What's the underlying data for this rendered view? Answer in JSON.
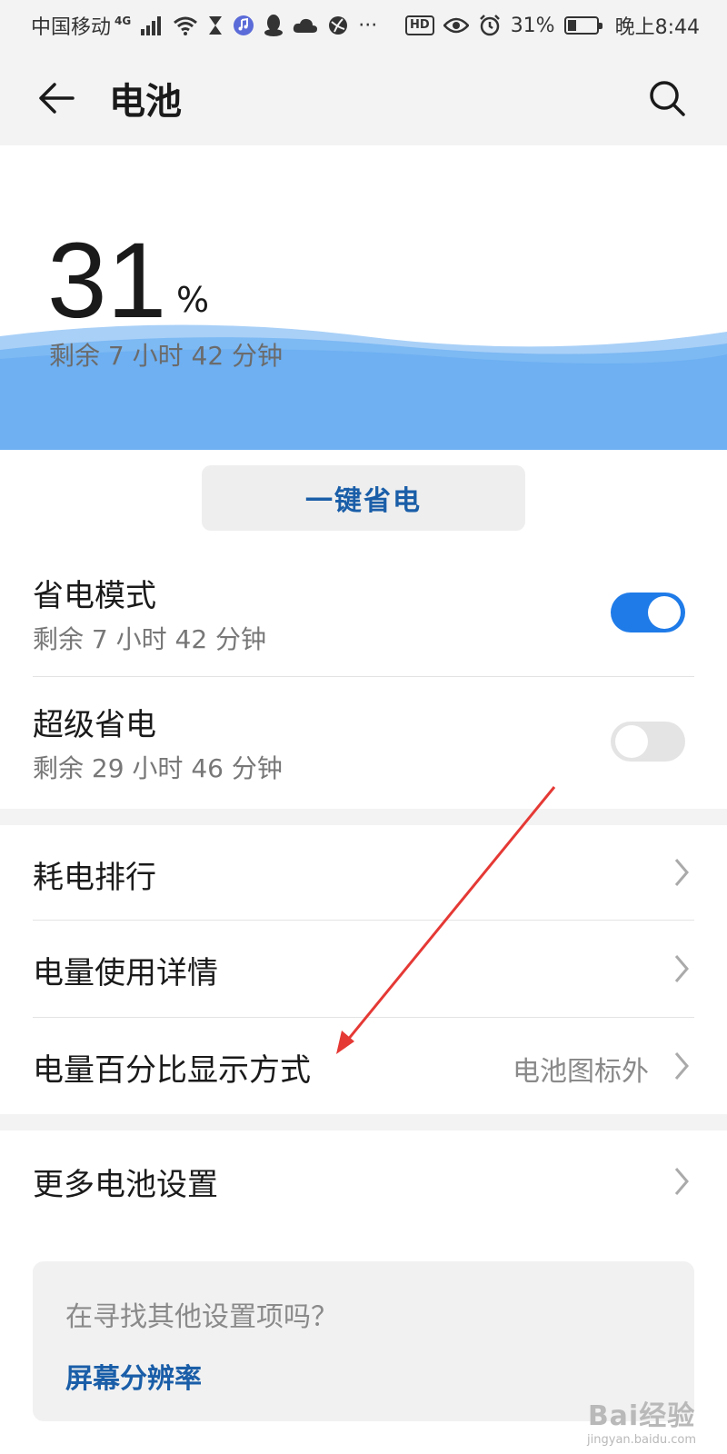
{
  "statusbar": {
    "carrier": "中国移动",
    "network": "4G",
    "hd_label": "HD",
    "battery_percent": "31%",
    "time": "晚上8:44",
    "battery_level": 0.31
  },
  "header": {
    "title": "电池"
  },
  "hero": {
    "percent_value": "31",
    "percent_sign": "%",
    "remaining": "剩余 7 小时 42 分钟",
    "wave_color": "#6eb0f2"
  },
  "one_key_button": {
    "label": "一键省电"
  },
  "power_saving": {
    "title": "省电模式",
    "subtitle": "剩余 7 小时 42 分钟",
    "enabled": true
  },
  "ultra_saving": {
    "title": "超级省电",
    "subtitle": "剩余 29 小时 46 分钟",
    "enabled": false
  },
  "menu": {
    "ranking": {
      "label": "耗电排行"
    },
    "usage_details": {
      "label": "电量使用详情"
    },
    "percent_display": {
      "label": "电量百分比显示方式",
      "value": "电池图标外"
    },
    "more_settings": {
      "label": "更多电池设置"
    }
  },
  "suggestion": {
    "question": "在寻找其他设置项吗？",
    "link": "屏幕分辨率"
  },
  "watermark": {
    "main": "Bai经验",
    "sub": "jingyan.baidu.com"
  },
  "colors": {
    "accent": "#1f7be8",
    "link": "#1a5ea8",
    "annotation_arrow": "#e53935"
  },
  "icons": [
    "back-arrow-icon",
    "search-icon",
    "chevron-right-icon",
    "wifi-icon",
    "signal-icon",
    "alarm-icon",
    "eye-icon",
    "battery-icon"
  ]
}
